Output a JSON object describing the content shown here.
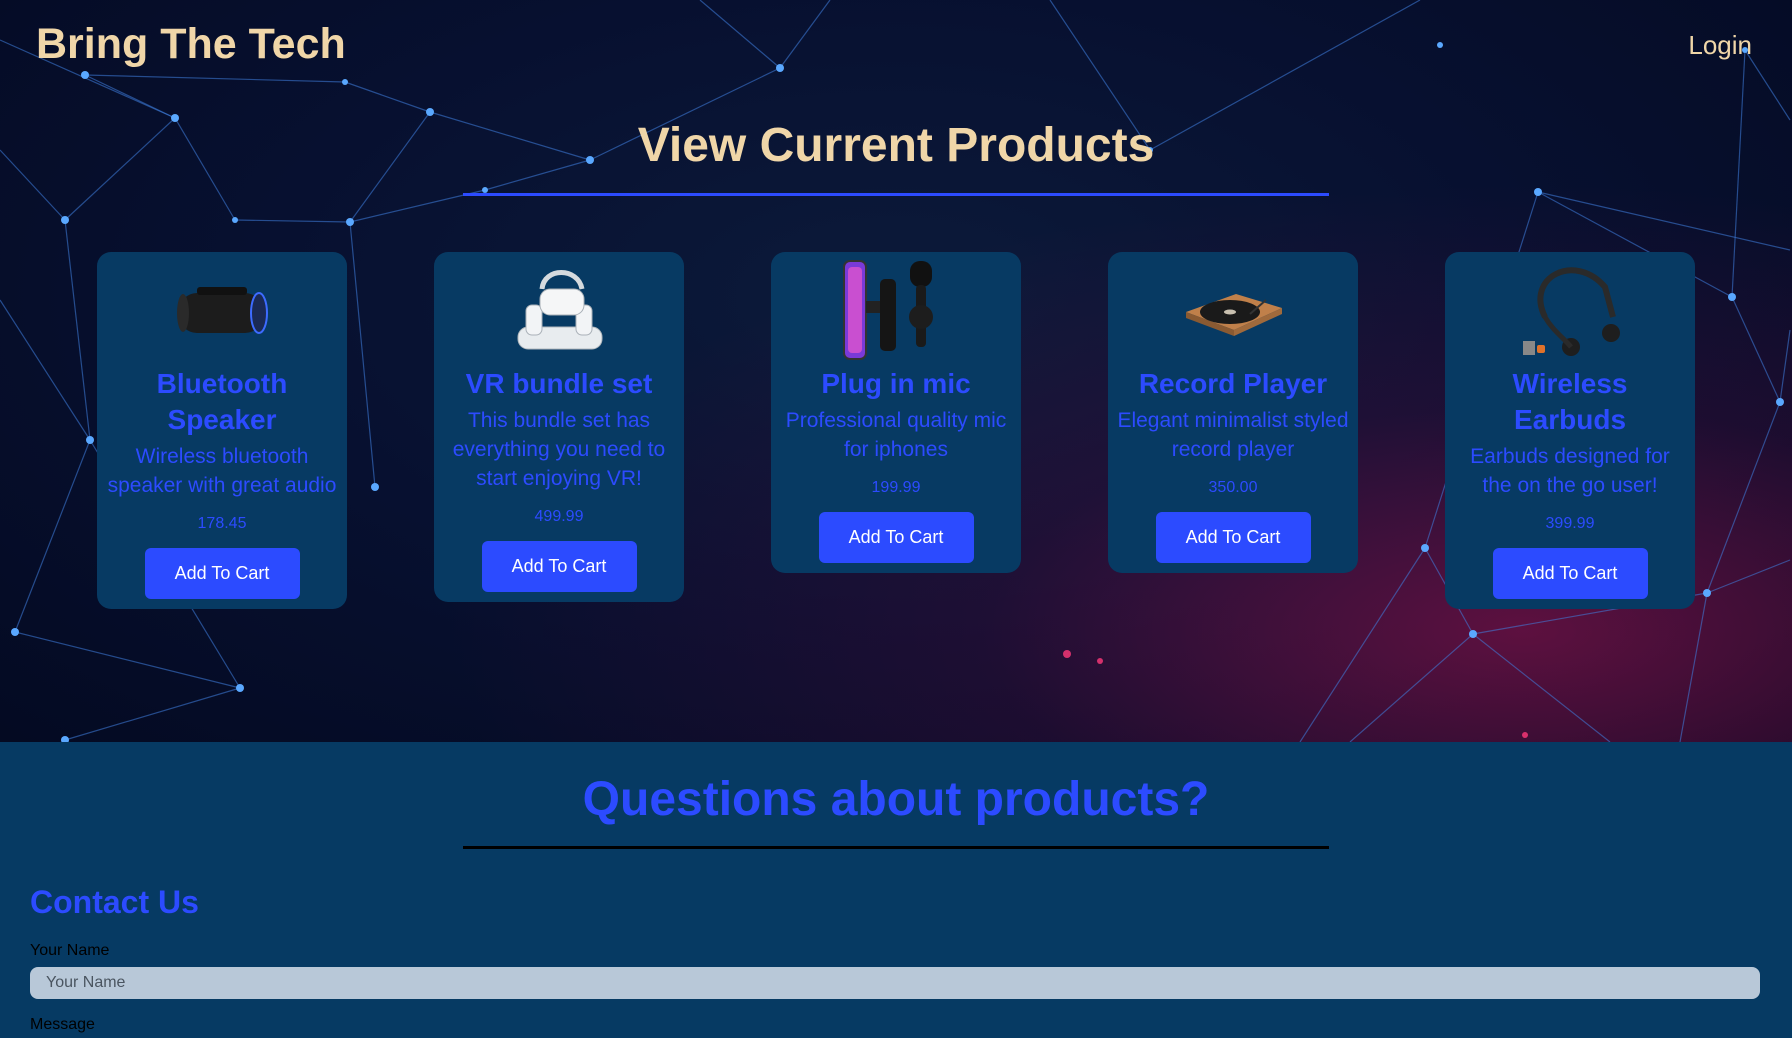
{
  "header": {
    "brand": "Bring The Tech",
    "login_label": "Login"
  },
  "products_section": {
    "title": "View Current Products",
    "button_label": "Add To Cart",
    "items": [
      {
        "name": "Bluetooth Speaker",
        "description": "Wireless bluetooth speaker with great audio",
        "price": "178.45",
        "icon": "bluetooth-speaker-icon"
      },
      {
        "name": "VR bundle set",
        "description": "This bundle set has everything you need to start enjoying VR!",
        "price": "499.99",
        "icon": "vr-headset-icon"
      },
      {
        "name": "Plug in mic",
        "description": "Professional quality mic for iphones",
        "price": "199.99",
        "icon": "microphone-icon"
      },
      {
        "name": "Record Player",
        "description": "Elegant minimalist styled record player",
        "price": "350.00",
        "icon": "record-player-icon"
      },
      {
        "name": "Wireless Earbuds",
        "description": "Earbuds designed for the on the go user!",
        "price": "399.99",
        "icon": "earbuds-icon"
      }
    ]
  },
  "contact": {
    "question_title": "Questions about products?",
    "heading": "Contact Us",
    "name_label": "Your Name",
    "name_placeholder": "Your Name",
    "message_label": "Message"
  },
  "colors": {
    "accent": "#2c4bff",
    "brand_text": "#f0d6a8",
    "card_bg": "#073a63",
    "page_bg": "#063a63"
  }
}
